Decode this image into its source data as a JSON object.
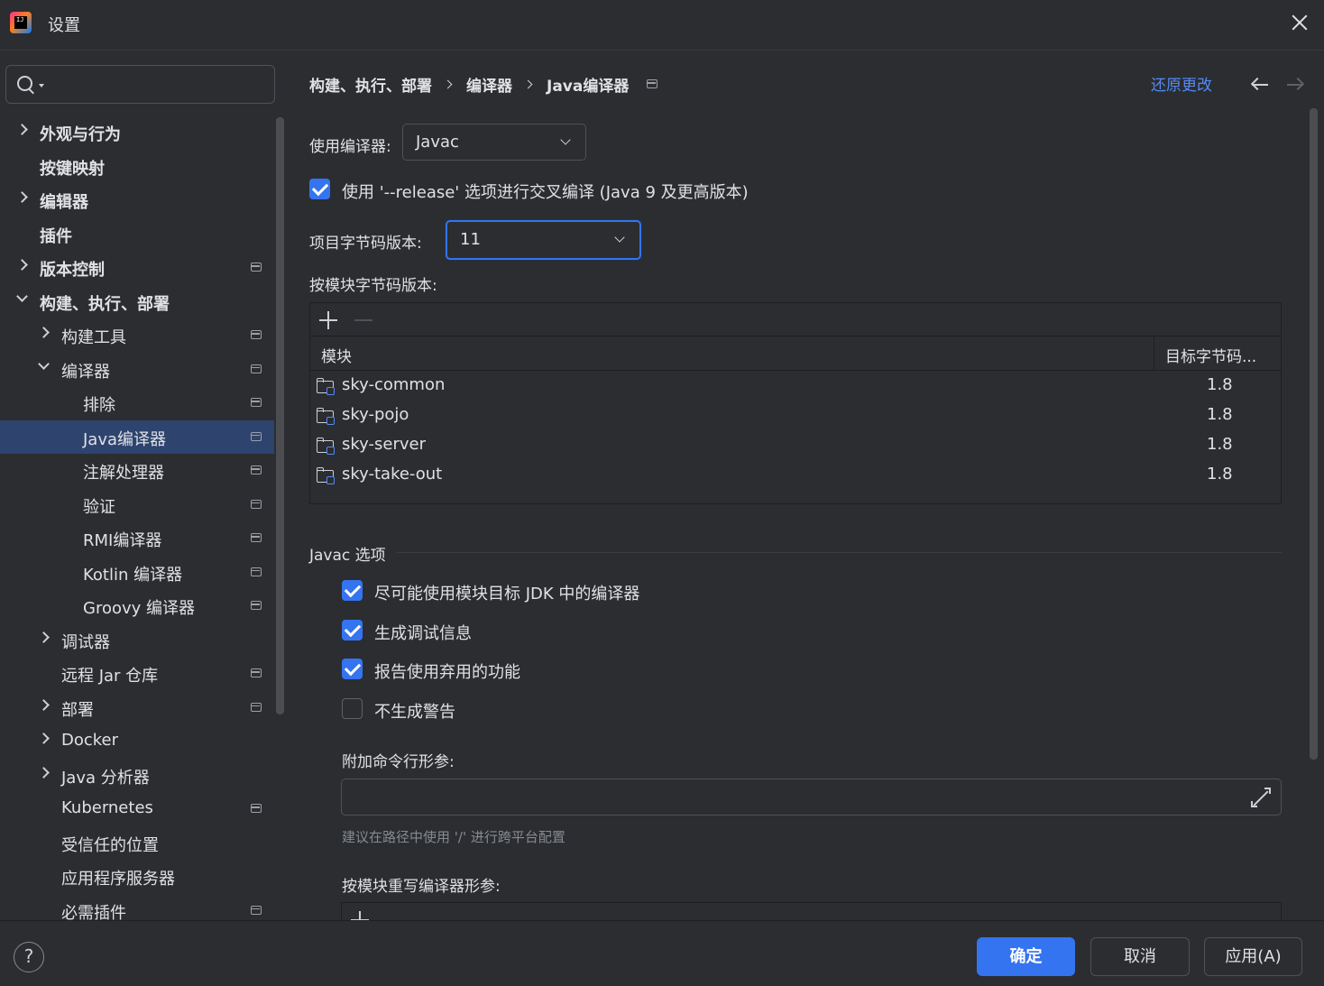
{
  "window": {
    "title": "设置",
    "logo_text": "IJ"
  },
  "search": {
    "placeholder": "",
    "value": ""
  },
  "tree": [
    {
      "label": "外观与行为",
      "bold": true,
      "expand": "r",
      "level": 0,
      "proj": false
    },
    {
      "label": "按键映射",
      "bold": true,
      "expand": "",
      "level": 0,
      "proj": false
    },
    {
      "label": "编辑器",
      "bold": true,
      "expand": "r",
      "level": 0,
      "proj": false
    },
    {
      "label": "插件",
      "bold": true,
      "expand": "",
      "level": 0,
      "proj": false
    },
    {
      "label": "版本控制",
      "bold": true,
      "expand": "r",
      "level": 0,
      "proj": true
    },
    {
      "label": "构建、执行、部署",
      "bold": true,
      "expand": "d",
      "level": 0,
      "proj": false
    },
    {
      "label": "构建工具",
      "bold": false,
      "expand": "r",
      "level": 1,
      "proj": true
    },
    {
      "label": "编译器",
      "bold": false,
      "expand": "d",
      "level": 1,
      "proj": true
    },
    {
      "label": "排除",
      "bold": false,
      "expand": "",
      "level": 2,
      "proj": true
    },
    {
      "label": "Java编译器",
      "bold": false,
      "expand": "",
      "level": 2,
      "proj": true,
      "selected": true
    },
    {
      "label": "注解处理器",
      "bold": false,
      "expand": "",
      "level": 2,
      "proj": true
    },
    {
      "label": "验证",
      "bold": false,
      "expand": "",
      "level": 2,
      "proj": true
    },
    {
      "label": "RMI编译器",
      "bold": false,
      "expand": "",
      "level": 2,
      "proj": true
    },
    {
      "label": "Kotlin 编译器",
      "bold": false,
      "expand": "",
      "level": 2,
      "proj": true
    },
    {
      "label": "Groovy 编译器",
      "bold": false,
      "expand": "",
      "level": 2,
      "proj": true
    },
    {
      "label": "调试器",
      "bold": false,
      "expand": "r",
      "level": 1,
      "proj": false
    },
    {
      "label": "远程 Jar 仓库",
      "bold": false,
      "expand": "",
      "level": 1,
      "proj": true
    },
    {
      "label": "部署",
      "bold": false,
      "expand": "r",
      "level": 1,
      "proj": true
    },
    {
      "label": "Docker",
      "bold": false,
      "expand": "r",
      "level": 1,
      "proj": false
    },
    {
      "label": "Java 分析器",
      "bold": false,
      "expand": "r",
      "level": 1,
      "proj": false
    },
    {
      "label": "Kubernetes",
      "bold": false,
      "expand": "",
      "level": 1,
      "proj": true
    },
    {
      "label": "受信任的位置",
      "bold": false,
      "expand": "",
      "level": 1,
      "proj": false
    },
    {
      "label": "应用程序服务器",
      "bold": false,
      "expand": "",
      "level": 1,
      "proj": false
    },
    {
      "label": "必需插件",
      "bold": false,
      "expand": "",
      "level": 1,
      "proj": true
    }
  ],
  "breadcrumb": [
    "构建、执行、部署",
    "编译器",
    "Java编译器"
  ],
  "header": {
    "revert": "还原更改"
  },
  "compiler": {
    "label": "使用编译器:",
    "value": "Javac"
  },
  "release_option": {
    "label": "使用 '--release' 选项进行交叉编译 (Java 9 及更高版本)",
    "checked": true
  },
  "bytecode": {
    "label": "项目字节码版本:",
    "value": "11"
  },
  "module_bytecode": {
    "label": "按模块字节码版本:",
    "columns": [
      "模块",
      "目标字节码..."
    ],
    "rows": [
      {
        "module": "sky-common",
        "version": "1.8"
      },
      {
        "module": "sky-pojo",
        "version": "1.8"
      },
      {
        "module": "sky-server",
        "version": "1.8"
      },
      {
        "module": "sky-take-out",
        "version": "1.8"
      }
    ]
  },
  "javac": {
    "section": "Javac 选项",
    "options": [
      {
        "label": "尽可能使用模块目标 JDK 中的编译器",
        "checked": true
      },
      {
        "label": "生成调试信息",
        "checked": true
      },
      {
        "label": "报告使用弃用的功能",
        "checked": true
      },
      {
        "label": "不生成警告",
        "checked": false
      }
    ],
    "args_label": "附加命令行形参:",
    "args_value": "",
    "hint": "建议在路径中使用 '/' 进行跨平台配置",
    "override_label": "按模块重写编译器形参:"
  },
  "footer": {
    "help": "?",
    "ok": "确定",
    "cancel": "取消",
    "apply": "应用(A)"
  },
  "colors": {
    "accent": "#3574f0",
    "link": "#548af7",
    "selection": "#2e436e",
    "background": "#2b2d30"
  }
}
